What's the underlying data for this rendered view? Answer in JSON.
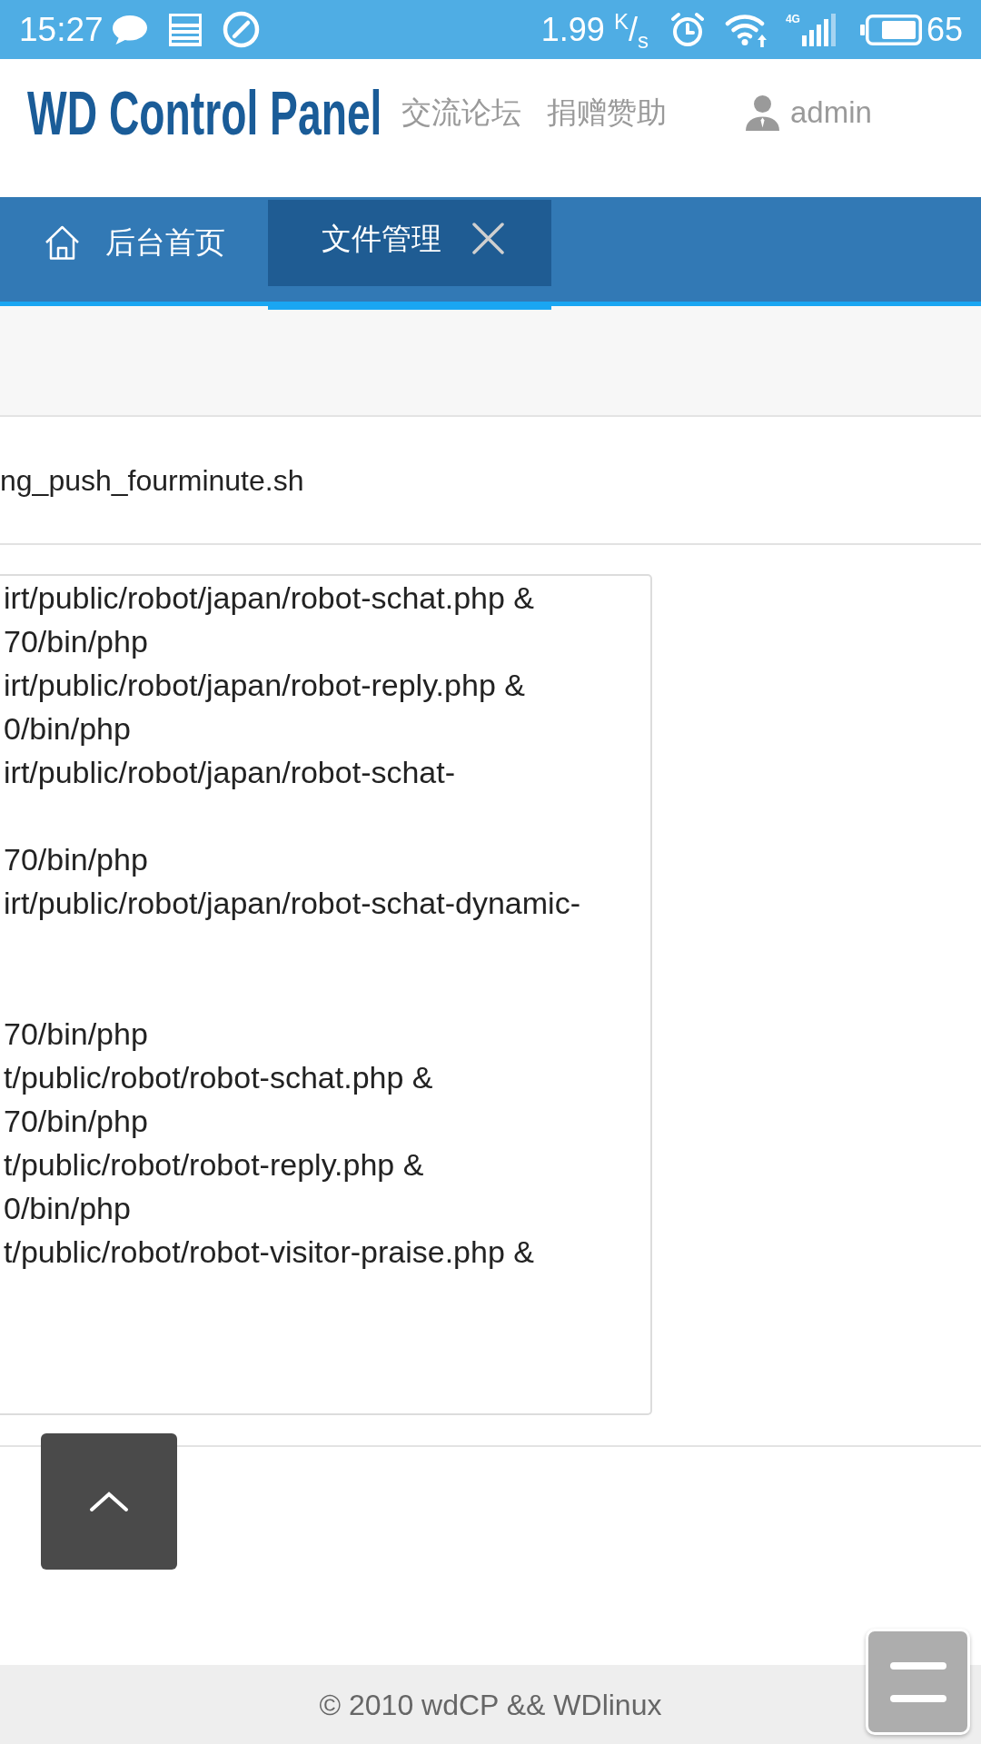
{
  "status_bar": {
    "time": "15:27",
    "network_speed": "1.99 $^{K}$/$_{s}$",
    "network_type": "4G",
    "battery": "65"
  },
  "header": {
    "logo": "WD Control Panel",
    "links": [
      "交流论坛",
      "捐赠赞助"
    ],
    "user": "admin"
  },
  "tabs": [
    {
      "label": "后台首页",
      "kind": "home",
      "selected": false
    },
    {
      "label": "文件管理",
      "kind": "closable",
      "selected": true
    }
  ],
  "file_name": "ng_push_fourminute.sh",
  "editor": {
    "text": "irt/public/robot/japan/robot-schat.php &\n70/bin/php\nirt/public/robot/japan/robot-reply.php &\n0/bin/php\nirt/public/robot/japan/robot-schat-\n\n70/bin/php\nirt/public/robot/japan/robot-schat-dynamic-\n\n\n70/bin/php\nt/public/robot/robot-schat.php &\n70/bin/php\nt/public/robot/robot-reply.php &\n0/bin/php\nt/public/robot/robot-visitor-praise.php &"
  },
  "footer": {
    "copyright": "© 2010 wdCP && WDlinux"
  }
}
